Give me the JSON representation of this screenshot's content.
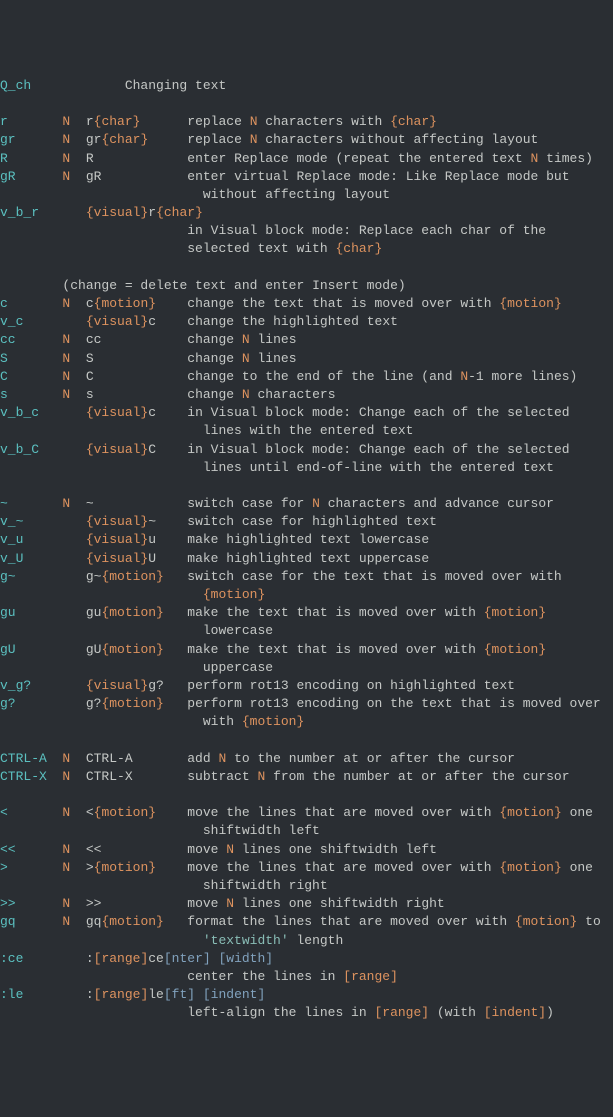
{
  "section": {
    "tag": "Q_ch",
    "title": "Changing text"
  },
  "rows": [
    {
      "tag": "r",
      "n": "N",
      "cmd": [
        {
          "t": "r",
          "c": "gray"
        },
        {
          "t": "{char}",
          "c": "orange"
        }
      ],
      "desc": [
        {
          "t": "replace ",
          "c": "gray"
        },
        {
          "t": "N",
          "c": "orange"
        },
        {
          "t": " characters with ",
          "c": "gray"
        },
        {
          "t": "{char}",
          "c": "orange"
        }
      ]
    },
    {
      "tag": "gr",
      "n": "N",
      "cmd": [
        {
          "t": "gr",
          "c": "gray"
        },
        {
          "t": "{char}",
          "c": "orange"
        }
      ],
      "desc": [
        {
          "t": "replace ",
          "c": "gray"
        },
        {
          "t": "N",
          "c": "orange"
        },
        {
          "t": " characters without affecting layout",
          "c": "gray"
        }
      ]
    },
    {
      "tag": "R",
      "n": "N",
      "cmd": [
        {
          "t": "R",
          "c": "gray"
        }
      ],
      "desc": [
        {
          "t": "enter Replace mode (repeat the entered text ",
          "c": "gray"
        },
        {
          "t": "N",
          "c": "orange"
        },
        {
          "t": " times)",
          "c": "gray"
        }
      ]
    },
    {
      "tag": "gR",
      "n": "N",
      "cmd": [
        {
          "t": "gR",
          "c": "gray"
        }
      ],
      "desc": [
        {
          "t": "enter virtual Replace mode: Like Replace mode but",
          "c": "gray"
        }
      ]
    },
    {
      "cont": true,
      "desc": [
        {
          "t": "  without affecting layout",
          "c": "gray"
        }
      ]
    },
    {
      "tag": "v_b_r",
      "cmd": [
        {
          "t": "{visual}",
          "c": "orange"
        },
        {
          "t": "r",
          "c": "gray"
        },
        {
          "t": "{char}",
          "c": "orange"
        }
      ],
      "desc": []
    },
    {
      "cont": true,
      "desc": [
        {
          "t": "in Visual block mode: Replace each char of the",
          "c": "gray"
        }
      ]
    },
    {
      "cont": true,
      "desc": [
        {
          "t": "selected text with ",
          "c": "gray"
        },
        {
          "t": "{char}",
          "c": "orange"
        }
      ]
    },
    {
      "blank": true
    },
    {
      "note": "(change = delete text and enter Insert mode)"
    },
    {
      "tag": "c",
      "n": "N",
      "cmd": [
        {
          "t": "c",
          "c": "gray"
        },
        {
          "t": "{motion}",
          "c": "orange"
        }
      ],
      "desc": [
        {
          "t": "change the text that is moved over with ",
          "c": "gray"
        },
        {
          "t": "{motion}",
          "c": "orange"
        }
      ]
    },
    {
      "tag": "v_c",
      "cmd": [
        {
          "t": "{visual}",
          "c": "orange"
        },
        {
          "t": "c",
          "c": "gray"
        }
      ],
      "desc": [
        {
          "t": "change the highlighted text",
          "c": "gray"
        }
      ]
    },
    {
      "tag": "cc",
      "n": "N",
      "cmd": [
        {
          "t": "cc",
          "c": "gray"
        }
      ],
      "desc": [
        {
          "t": "change ",
          "c": "gray"
        },
        {
          "t": "N",
          "c": "orange"
        },
        {
          "t": " lines",
          "c": "gray"
        }
      ]
    },
    {
      "tag": "S",
      "n": "N",
      "cmd": [
        {
          "t": "S",
          "c": "gray"
        }
      ],
      "desc": [
        {
          "t": "change ",
          "c": "gray"
        },
        {
          "t": "N",
          "c": "orange"
        },
        {
          "t": " lines",
          "c": "gray"
        }
      ]
    },
    {
      "tag": "C",
      "n": "N",
      "cmd": [
        {
          "t": "C",
          "c": "gray"
        }
      ],
      "desc": [
        {
          "t": "change to the end of the line (and ",
          "c": "gray"
        },
        {
          "t": "N",
          "c": "orange"
        },
        {
          "t": "-1 more lines)",
          "c": "gray"
        }
      ]
    },
    {
      "tag": "s",
      "n": "N",
      "cmd": [
        {
          "t": "s",
          "c": "gray"
        }
      ],
      "desc": [
        {
          "t": "change ",
          "c": "gray"
        },
        {
          "t": "N",
          "c": "orange"
        },
        {
          "t": " characters",
          "c": "gray"
        }
      ]
    },
    {
      "tag": "v_b_c",
      "cmd": [
        {
          "t": "{visual}",
          "c": "orange"
        },
        {
          "t": "c",
          "c": "gray"
        }
      ],
      "desc": [
        {
          "t": "in Visual block mode: Change each of the selected",
          "c": "gray"
        }
      ]
    },
    {
      "cont": true,
      "desc": [
        {
          "t": "  lines with the entered text",
          "c": "gray"
        }
      ]
    },
    {
      "tag": "v_b_C",
      "cmd": [
        {
          "t": "{visual}",
          "c": "orange"
        },
        {
          "t": "C",
          "c": "gray"
        }
      ],
      "desc": [
        {
          "t": "in Visual block mode: Change each of the selected",
          "c": "gray"
        }
      ]
    },
    {
      "cont": true,
      "desc": [
        {
          "t": "  lines until end-of-line with the entered text",
          "c": "gray"
        }
      ]
    },
    {
      "blank": true
    },
    {
      "tag": "~",
      "n": "N",
      "cmd": [
        {
          "t": "~",
          "c": "gray"
        }
      ],
      "desc": [
        {
          "t": "switch case for ",
          "c": "gray"
        },
        {
          "t": "N",
          "c": "orange"
        },
        {
          "t": " characters and advance cursor",
          "c": "gray"
        }
      ]
    },
    {
      "tag": "v_~",
      "cmd": [
        {
          "t": "{visual}",
          "c": "orange"
        },
        {
          "t": "~",
          "c": "gray"
        }
      ],
      "desc": [
        {
          "t": "switch case for highlighted text",
          "c": "gray"
        }
      ]
    },
    {
      "tag": "v_u",
      "cmd": [
        {
          "t": "{visual}",
          "c": "orange"
        },
        {
          "t": "u",
          "c": "gray"
        }
      ],
      "desc": [
        {
          "t": "make highlighted text lowercase",
          "c": "gray"
        }
      ]
    },
    {
      "tag": "v_U",
      "cmd": [
        {
          "t": "{visual}",
          "c": "orange"
        },
        {
          "t": "U",
          "c": "gray"
        }
      ],
      "desc": [
        {
          "t": "make highlighted text uppercase",
          "c": "gray"
        }
      ]
    },
    {
      "tag": "g~",
      "cmd": [
        {
          "t": "g~",
          "c": "gray"
        },
        {
          "t": "{motion}",
          "c": "orange"
        }
      ],
      "desc": [
        {
          "t": "switch case for the text that is moved over with",
          "c": "gray"
        }
      ]
    },
    {
      "cont": true,
      "desc": [
        {
          "t": "  ",
          "c": "gray"
        },
        {
          "t": "{motion}",
          "c": "orange"
        }
      ]
    },
    {
      "tag": "gu",
      "cmd": [
        {
          "t": "gu",
          "c": "gray"
        },
        {
          "t": "{motion}",
          "c": "orange"
        }
      ],
      "desc": [
        {
          "t": "make the text that is moved over with ",
          "c": "gray"
        },
        {
          "t": "{motion}",
          "c": "orange"
        }
      ]
    },
    {
      "cont": true,
      "desc": [
        {
          "t": "  lowercase",
          "c": "gray"
        }
      ]
    },
    {
      "tag": "gU",
      "cmd": [
        {
          "t": "gU",
          "c": "gray"
        },
        {
          "t": "{motion}",
          "c": "orange"
        }
      ],
      "desc": [
        {
          "t": "make the text that is moved over with ",
          "c": "gray"
        },
        {
          "t": "{motion}",
          "c": "orange"
        }
      ]
    },
    {
      "cont": true,
      "desc": [
        {
          "t": "  uppercase",
          "c": "gray"
        }
      ]
    },
    {
      "tag": "v_g?",
      "cmd": [
        {
          "t": "{visual}",
          "c": "orange"
        },
        {
          "t": "g?",
          "c": "gray"
        }
      ],
      "desc": [
        {
          "t": "perform rot13 encoding on highlighted text",
          "c": "gray"
        }
      ]
    },
    {
      "tag": "g?",
      "cmd": [
        {
          "t": "g?",
          "c": "gray"
        },
        {
          "t": "{motion}",
          "c": "orange"
        }
      ],
      "desc": [
        {
          "t": "perform rot13 encoding on the text that is moved over",
          "c": "gray"
        }
      ]
    },
    {
      "cont": true,
      "desc": [
        {
          "t": "  with ",
          "c": "gray"
        },
        {
          "t": "{motion}",
          "c": "orange"
        }
      ]
    },
    {
      "blank": true
    },
    {
      "tag": "CTRL-A",
      "n": "N",
      "cmd": [
        {
          "t": "CTRL-A",
          "c": "gray"
        }
      ],
      "desc": [
        {
          "t": "add ",
          "c": "gray"
        },
        {
          "t": "N",
          "c": "orange"
        },
        {
          "t": " to the number at or after the cursor",
          "c": "gray"
        }
      ]
    },
    {
      "tag": "CTRL-X",
      "n": "N",
      "cmd": [
        {
          "t": "CTRL-X",
          "c": "gray"
        }
      ],
      "desc": [
        {
          "t": "subtract ",
          "c": "gray"
        },
        {
          "t": "N",
          "c": "orange"
        },
        {
          "t": " from the number at or after the cursor",
          "c": "gray"
        }
      ]
    },
    {
      "blank": true
    },
    {
      "tag": "<",
      "n": "N",
      "cmd": [
        {
          "t": "<",
          "c": "gray"
        },
        {
          "t": "{motion}",
          "c": "orange"
        }
      ],
      "desc": [
        {
          "t": "move the lines that are moved over with ",
          "c": "gray"
        },
        {
          "t": "{motion}",
          "c": "orange"
        },
        {
          "t": " one",
          "c": "gray"
        }
      ]
    },
    {
      "cont": true,
      "desc": [
        {
          "t": "  shiftwidth left",
          "c": "gray"
        }
      ]
    },
    {
      "tag": "<<",
      "n": "N",
      "cmd": [
        {
          "t": "<<",
          "c": "gray"
        }
      ],
      "desc": [
        {
          "t": "move ",
          "c": "gray"
        },
        {
          "t": "N",
          "c": "orange"
        },
        {
          "t": " lines one shiftwidth left",
          "c": "gray"
        }
      ]
    },
    {
      "tag": ">",
      "n": "N",
      "cmd": [
        {
          "t": ">",
          "c": "gray"
        },
        {
          "t": "{motion}",
          "c": "orange"
        }
      ],
      "desc": [
        {
          "t": "move the lines that are moved over with ",
          "c": "gray"
        },
        {
          "t": "{motion}",
          "c": "orange"
        },
        {
          "t": " one",
          "c": "gray"
        }
      ]
    },
    {
      "cont": true,
      "desc": [
        {
          "t": "  shiftwidth right",
          "c": "gray"
        }
      ]
    },
    {
      "tag": ">>",
      "n": "N",
      "cmd": [
        {
          "t": ">>",
          "c": "gray"
        }
      ],
      "desc": [
        {
          "t": "move ",
          "c": "gray"
        },
        {
          "t": "N",
          "c": "orange"
        },
        {
          "t": " lines one shiftwidth right",
          "c": "gray"
        }
      ]
    },
    {
      "tag": "gq",
      "n": "N",
      "cmd": [
        {
          "t": "gq",
          "c": "gray"
        },
        {
          "t": "{motion}",
          "c": "orange"
        }
      ],
      "desc": [
        {
          "t": "format the lines that are moved over with ",
          "c": "gray"
        },
        {
          "t": "{motion}",
          "c": "orange"
        },
        {
          "t": " to",
          "c": "gray"
        }
      ]
    },
    {
      "cont": true,
      "desc": [
        {
          "t": "  ",
          "c": "gray"
        },
        {
          "t": "'textwidth'",
          "c": "teal"
        },
        {
          "t": " length",
          "c": "gray"
        }
      ]
    },
    {
      "tag": ":ce",
      "ex": true,
      "cmd": [
        {
          "t": ":",
          "c": "gray"
        },
        {
          "t": "[range]",
          "c": "orange"
        },
        {
          "t": "ce",
          "c": "gray"
        },
        {
          "t": "[nter] [width]",
          "c": "blue"
        }
      ],
      "desc": []
    },
    {
      "cont": true,
      "desc": [
        {
          "t": "center the lines in ",
          "c": "gray"
        },
        {
          "t": "[range]",
          "c": "orange"
        }
      ]
    },
    {
      "tag": ":le",
      "ex": true,
      "cmd": [
        {
          "t": ":",
          "c": "gray"
        },
        {
          "t": "[range]",
          "c": "orange"
        },
        {
          "t": "le",
          "c": "gray"
        },
        {
          "t": "[ft] [indent]",
          "c": "blue"
        }
      ],
      "desc": []
    },
    {
      "cont": true,
      "desc": [
        {
          "t": "left-align the lines in ",
          "c": "gray"
        },
        {
          "t": "[range]",
          "c": "orange"
        },
        {
          "t": " (with ",
          "c": "gray"
        },
        {
          "t": "[indent]",
          "c": "orange"
        },
        {
          "t": ")",
          "c": "gray"
        }
      ]
    }
  ],
  "columns": {
    "tagWidth": 8,
    "nWidth": 3,
    "cmdWidth": 11,
    "descStart": 24
  }
}
